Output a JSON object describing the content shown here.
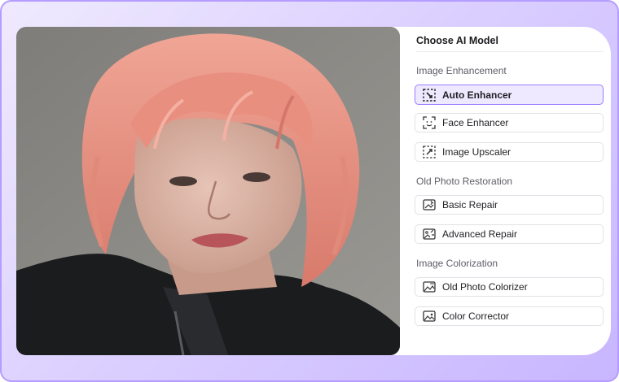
{
  "panel": {
    "title": "Choose AI Model",
    "sections": [
      {
        "label": "Image Enhancement",
        "items": [
          {
            "label": "Auto Enhancer",
            "icon": "auto-enhance-icon",
            "selected": true
          },
          {
            "label": "Face Enhancer",
            "icon": "face-scan-icon",
            "selected": false
          },
          {
            "label": "Image Upscaler",
            "icon": "upscale-icon",
            "selected": false
          }
        ]
      },
      {
        "label": "Old Photo Restoration",
        "items": [
          {
            "label": "Basic Repair",
            "icon": "photo-repair-icon",
            "selected": false
          },
          {
            "label": "Advanced Repair",
            "icon": "photo-advanced-repair-icon",
            "selected": false
          }
        ]
      },
      {
        "label": "Image Colorization",
        "items": [
          {
            "label": "Old Photo Colorizer",
            "icon": "photo-colorize-icon",
            "selected": false
          },
          {
            "label": "Color Corrector",
            "icon": "image-icon",
            "selected": false
          }
        ]
      }
    ]
  },
  "colors": {
    "accent": "#9b7bff",
    "accent_bg": "#efe9ff",
    "frame_border": "#b59cff",
    "hair": "#e88f80"
  }
}
